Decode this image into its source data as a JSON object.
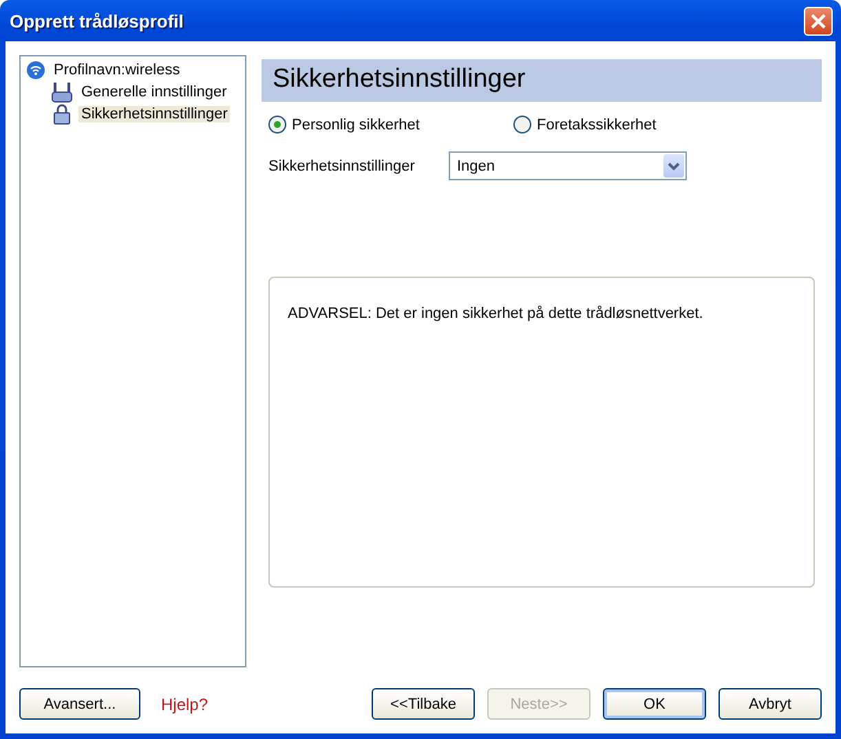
{
  "window": {
    "title": "Opprett trådløsprofil"
  },
  "tree": {
    "items": [
      {
        "label": "Profilnavn:wireless",
        "kind": "network",
        "selected": false,
        "children": [
          {
            "label": "Generelle innstillinger",
            "kind": "general",
            "selected": false
          },
          {
            "label": "Sikkerhetsinnstillinger",
            "kind": "security",
            "selected": true
          }
        ]
      }
    ]
  },
  "header": "Sikkerhetsinnstillinger",
  "radios": [
    {
      "label": "Personlig sikkerhet",
      "selected": true
    },
    {
      "label": "Foretakssikkerhet",
      "selected": false
    }
  ],
  "security_setting": {
    "label": "Sikkerhetsinnstillinger",
    "value": "Ingen"
  },
  "warning": "ADVARSEL: Det er ingen sikkerhet på dette trådløsnettverket.",
  "buttons_left": [
    {
      "kind": "button",
      "label": "Avansert...",
      "disabled": false
    },
    {
      "kind": "link",
      "label": "Hjelp?",
      "disabled": false
    }
  ],
  "buttons_right": [
    {
      "kind": "button",
      "label": "<<Tilbake",
      "disabled": false,
      "default": false
    },
    {
      "kind": "button",
      "label": "Neste>>",
      "disabled": true,
      "default": false
    },
    {
      "kind": "button",
      "label": "OK",
      "disabled": false,
      "default": true
    },
    {
      "kind": "button",
      "label": "Avbryt",
      "disabled": false,
      "default": false
    }
  ]
}
